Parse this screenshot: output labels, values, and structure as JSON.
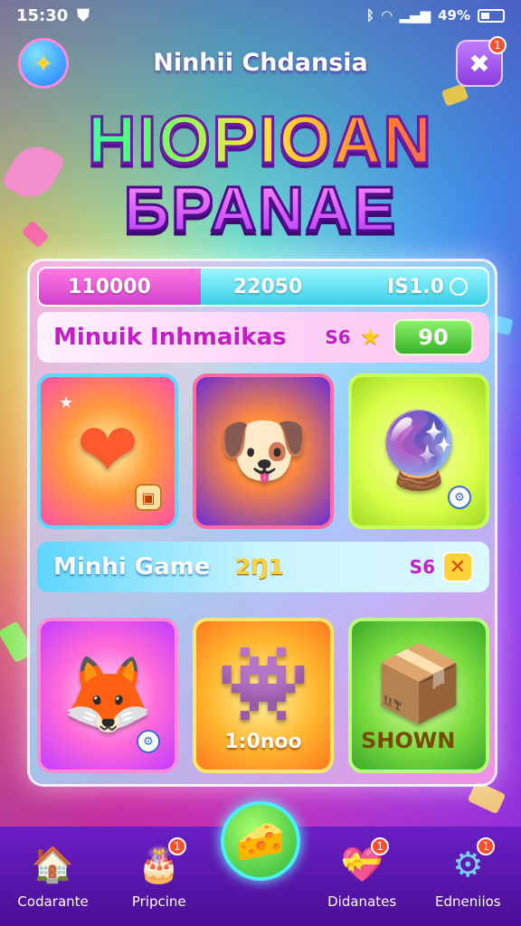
{
  "status_bar": {
    "time": "15:30",
    "battery": "49%"
  },
  "header": {
    "title": "Ninhii Chdansia",
    "left_icon": "cheese-star-icon",
    "right_icon": "puzzle-icon",
    "right_badge": "1"
  },
  "logo": {
    "line1": "HIOPIOAN",
    "line2": "БPANAE"
  },
  "stats": {
    "left": "110000",
    "middle": "22050",
    "right": "IS1.0"
  },
  "section1": {
    "title": "Minuik Inhmaikas",
    "meta": "S6",
    "button": "90"
  },
  "section2": {
    "title": "Minhi Game",
    "meta": "2Ŋ1",
    "meta2": "S6"
  },
  "tiles_row1": [
    {
      "icon": "heart-icon",
      "glyph": "❤"
    },
    {
      "icon": "dog-character-icon",
      "glyph": "🐶"
    },
    {
      "icon": "purple-orb-icon",
      "glyph": "🔮"
    }
  ],
  "tiles_row2": [
    {
      "icon": "fox-character-icon",
      "glyph": "🦊"
    },
    {
      "icon": "pink-monster-icon",
      "glyph": "👾",
      "label": "1:0noo"
    },
    {
      "icon": "boy-in-box-icon",
      "glyph": "📦",
      "label": "SHOWN"
    }
  ],
  "nav": [
    {
      "label": "Codarante",
      "icon": "home-icon",
      "glyph": "🏠",
      "badge": ""
    },
    {
      "label": "Pripcine",
      "icon": "cake-icon",
      "glyph": "🎂",
      "badge": "1"
    },
    {
      "label": "Didanates",
      "icon": "heart-box-icon",
      "glyph": "💝",
      "badge": "1"
    },
    {
      "label": "Edneniios",
      "icon": "gear-icon",
      "glyph": "⚙",
      "badge": "1"
    }
  ],
  "nav_center": {
    "icon": "cheese-icon",
    "glyph": "🧀"
  },
  "colors": {
    "accent": "#c21ec8",
    "nav_bg": "#5a16b0",
    "green": "#38b42a"
  }
}
